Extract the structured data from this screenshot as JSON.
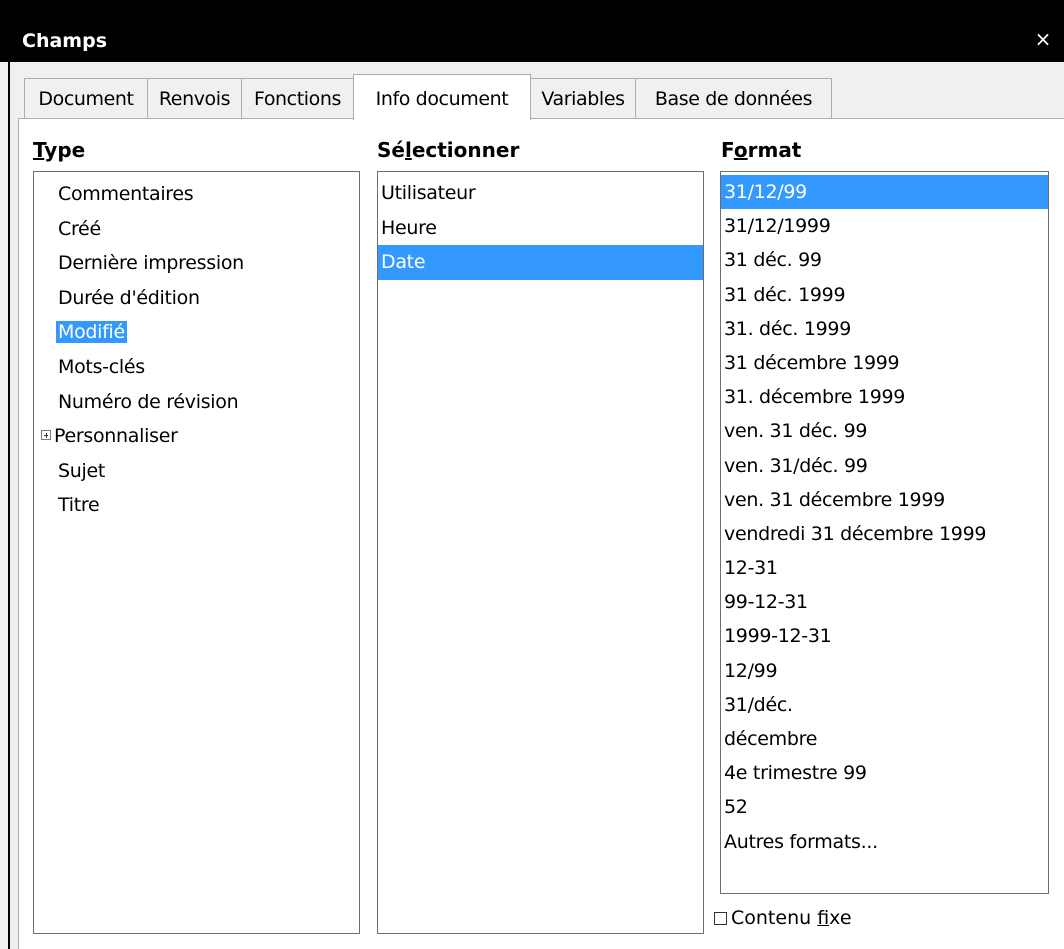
{
  "window": {
    "title": "Champs",
    "close_glyph": "×"
  },
  "tabs": [
    {
      "label": "Document",
      "active": false
    },
    {
      "label": "Renvois",
      "active": false
    },
    {
      "label": "Fonctions",
      "active": false
    },
    {
      "label": "Info document",
      "active": true
    },
    {
      "label": "Variables",
      "active": false
    },
    {
      "label": "Base de données",
      "active": false
    }
  ],
  "type_column": {
    "heading_pre": "",
    "heading_mnemonic": "T",
    "heading_post": "ype",
    "items": [
      {
        "label": "Commentaires",
        "selected": false,
        "expandable": false
      },
      {
        "label": "Créé",
        "selected": false,
        "expandable": false
      },
      {
        "label": "Dernière impression",
        "selected": false,
        "expandable": false
      },
      {
        "label": "Durée d'édition",
        "selected": false,
        "expandable": false
      },
      {
        "label": "Modifié",
        "selected": true,
        "expandable": false
      },
      {
        "label": "Mots-clés",
        "selected": false,
        "expandable": false
      },
      {
        "label": "Numéro de révision",
        "selected": false,
        "expandable": false
      },
      {
        "label": "Personnaliser",
        "selected": false,
        "expandable": true
      },
      {
        "label": "Sujet",
        "selected": false,
        "expandable": false
      },
      {
        "label": "Titre",
        "selected": false,
        "expandable": false
      }
    ]
  },
  "select_column": {
    "heading_pre": "Sé",
    "heading_mnemonic": "l",
    "heading_post": "ectionner",
    "items": [
      {
        "label": "Utilisateur",
        "selected": false
      },
      {
        "label": "Heure",
        "selected": false
      },
      {
        "label": "Date",
        "selected": true
      }
    ]
  },
  "format_column": {
    "heading_pre": "F",
    "heading_mnemonic": "o",
    "heading_post": "rmat",
    "items": [
      {
        "label": "31/12/99",
        "selected": true
      },
      {
        "label": "31/12/1999",
        "selected": false
      },
      {
        "label": "31 déc. 99",
        "selected": false
      },
      {
        "label": "31 déc. 1999",
        "selected": false
      },
      {
        "label": "31. déc. 1999",
        "selected": false
      },
      {
        "label": "31 décembre 1999",
        "selected": false
      },
      {
        "label": "31. décembre 1999",
        "selected": false
      },
      {
        "label": "ven. 31 déc. 99",
        "selected": false
      },
      {
        "label": "ven. 31/déc. 99",
        "selected": false
      },
      {
        "label": "ven. 31 décembre 1999",
        "selected": false
      },
      {
        "label": "vendredi 31 décembre 1999",
        "selected": false
      },
      {
        "label": "12-31",
        "selected": false
      },
      {
        "label": "99-12-31",
        "selected": false
      },
      {
        "label": "1999-12-31",
        "selected": false
      },
      {
        "label": "12/99",
        "selected": false
      },
      {
        "label": "31/déc.",
        "selected": false
      },
      {
        "label": "décembre",
        "selected": false
      },
      {
        "label": "4e trimestre 99",
        "selected": false
      },
      {
        "label": "52",
        "selected": false
      },
      {
        "label": "Autres formats...",
        "selected": false
      }
    ]
  },
  "fixed_content": {
    "label_pre": "Contenu ",
    "label_mnemonic": "f",
    "label_post": "ixe",
    "checked": false
  },
  "colors": {
    "selection": "#3399ff",
    "titlebar": "#000000"
  }
}
